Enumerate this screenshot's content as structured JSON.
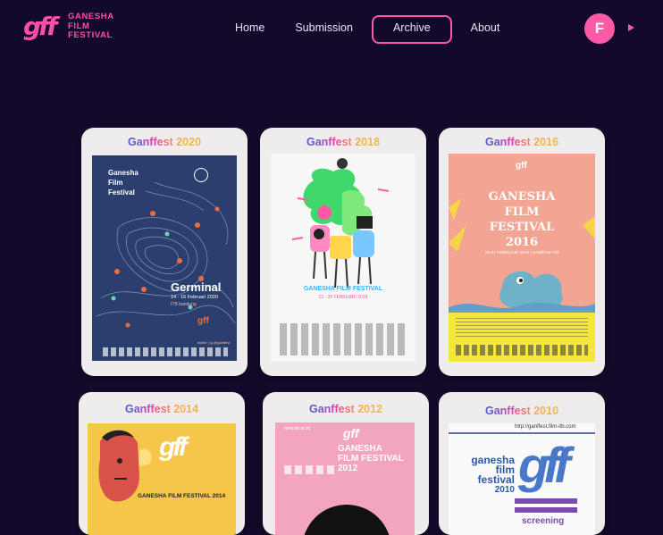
{
  "brand": {
    "mark": "gff",
    "lines": [
      "GANESHA",
      "FILM",
      "FESTIVAL"
    ],
    "accent": "#ff4fa8"
  },
  "nav": {
    "items": [
      {
        "label": "Home"
      },
      {
        "label": "Submission"
      },
      {
        "label": "Archive",
        "active": true
      },
      {
        "label": "About"
      }
    ]
  },
  "user": {
    "initial": "F",
    "menu_icon": "triangle-right-icon"
  },
  "archive": [
    {
      "title": "Ganffest 2020",
      "poster": {
        "heading": [
          "Ganesha",
          "Film",
          "Festival"
        ],
        "name": "Germinal",
        "dates": "14 - 16 Februari 2020",
        "venue": "ITB bandung",
        "contact": "twitter | ig @ganffest"
      }
    },
    {
      "title": "Ganffest 2018",
      "poster": {
        "name": "GANESHA FILM FESTIVAL",
        "dates": "23 - 25 FEBRUARI 2018"
      }
    },
    {
      "title": "Ganffest 2016",
      "poster": {
        "heading": [
          "GANESHA",
          "FILM",
          "FESTIVAL",
          "2016"
        ],
        "dates": "19-21 FEBRUARI 2016 | KAMPUS ITB"
      }
    },
    {
      "title": "Ganffest 2014",
      "poster": {
        "name": "GANESHA FILM FESTIVAL 2014"
      }
    },
    {
      "title": "Ganffest 2012",
      "poster": {
        "heading": [
          "GANESHA",
          "FILM FESTIVAL",
          "2012"
        ],
        "sub": "www.itb.ac.id"
      }
    },
    {
      "title": "Ganffest 2010",
      "poster": {
        "url": "http://ganffest.film-itb.com",
        "heading": [
          "ganesha",
          "film",
          "festival",
          "2010"
        ],
        "footer": "screening"
      }
    }
  ]
}
